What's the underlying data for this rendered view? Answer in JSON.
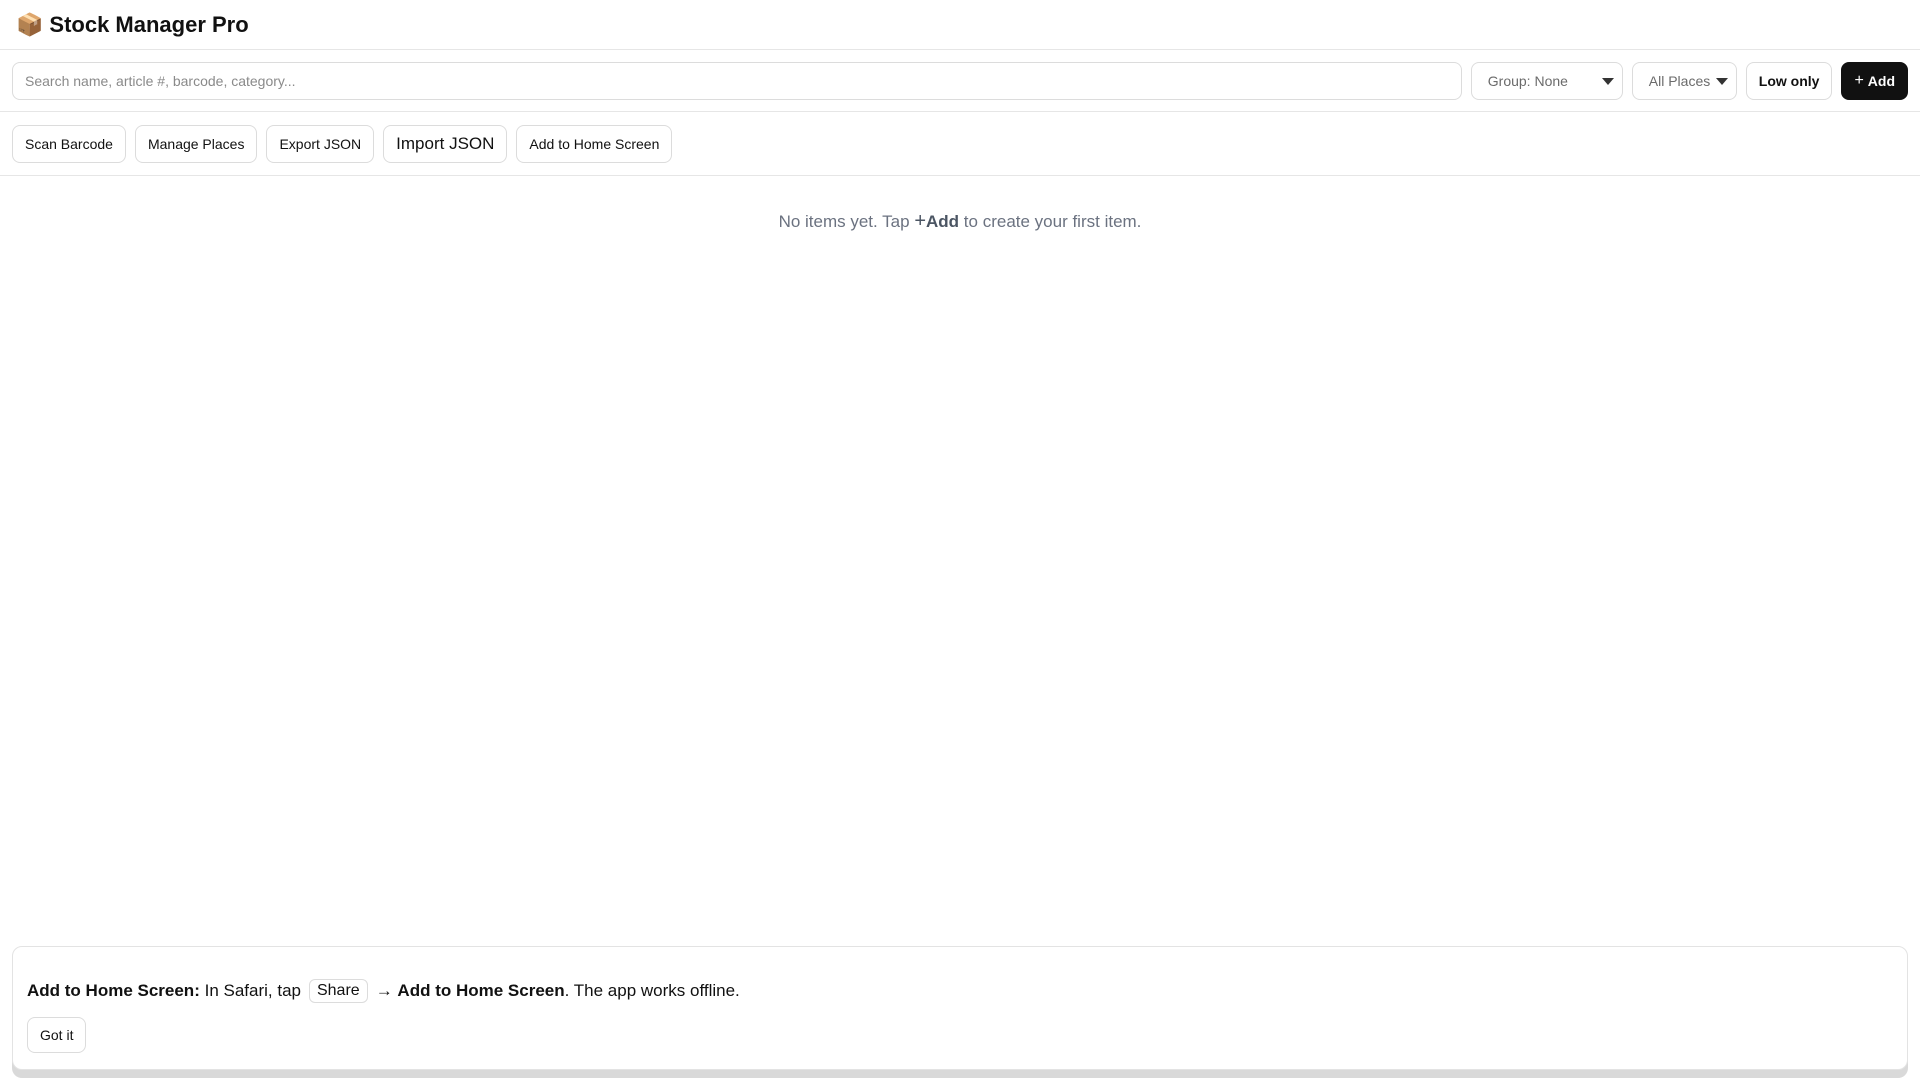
{
  "header": {
    "logo_icon": "package-box-icon",
    "logo_glyph": "📦",
    "title": "Stock Manager Pro"
  },
  "toolbar": {
    "search_placeholder": "Search name, article #, barcode, category...",
    "search_value": "",
    "group_select": {
      "selected": "Group: None"
    },
    "places_select": {
      "selected": "All Places"
    },
    "low_only_label": "Low only",
    "add_label": "Add",
    "add_plus": "+"
  },
  "actions": {
    "scan_barcode": "Scan Barcode",
    "manage_places": "Manage Places",
    "export_json": "Export JSON",
    "import_json": "Import JSON",
    "add_to_home": "Add to Home Screen"
  },
  "empty_state": {
    "prefix": "No items yet. Tap",
    "plus": "+",
    "add": "Add",
    "suffix": "to create your first item."
  },
  "install_banner": {
    "heading": "Add to Home Screen:",
    "text_1": "In Safari, tap",
    "share_key": "Share",
    "arrow": "→",
    "target": "Add to Home Screen",
    "text_2": ". The app works offline.",
    "got_it": "Got it"
  },
  "colors": {
    "primary": "#111111",
    "muted_text": "#6b7280",
    "border": "#dcdcdc"
  }
}
